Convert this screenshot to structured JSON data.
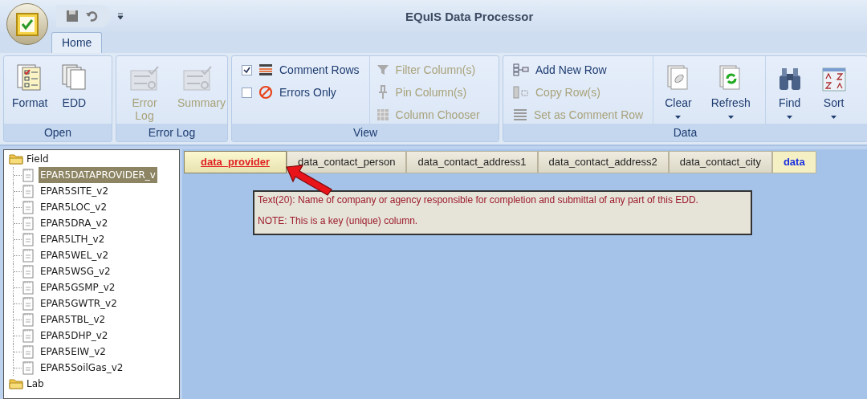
{
  "window": {
    "title": "EQuIS Data Processor"
  },
  "tabs": [
    {
      "label": "Home",
      "selected": true
    }
  ],
  "ribbon": {
    "groups": [
      {
        "label": "Open",
        "items": [
          {
            "kind": "large",
            "label": "Format",
            "disabled": false
          },
          {
            "kind": "large",
            "label": "EDD",
            "disabled": false
          }
        ]
      },
      {
        "label": "Error Log",
        "items": [
          {
            "kind": "large",
            "label": "Error Log",
            "disabled": true
          },
          {
            "kind": "large",
            "label": "Summary",
            "disabled": true
          }
        ]
      },
      {
        "label": "View",
        "columns": [
          [
            {
              "kind": "check",
              "label": "Comment Rows",
              "checked": true,
              "disabled": false
            },
            {
              "kind": "check",
              "label": "Errors Only",
              "checked": false,
              "disabled": false
            }
          ],
          [
            {
              "kind": "small",
              "label": "Filter Column(s)",
              "disabled": true
            },
            {
              "kind": "small",
              "label": "Pin Column(s)",
              "disabled": true
            },
            {
              "kind": "small",
              "label": "Column Chooser",
              "disabled": true
            }
          ]
        ]
      },
      {
        "label": "Data",
        "columns": [
          [
            {
              "kind": "small",
              "label": "Add New Row",
              "disabled": false
            },
            {
              "kind": "small",
              "label": "Copy Row(s)",
              "disabled": true
            },
            {
              "kind": "small",
              "label": "Set as Comment Row",
              "disabled": true
            }
          ],
          [
            {
              "kind": "large",
              "label": "Clear",
              "dropdown": true,
              "disabled": false
            },
            {
              "kind": "large",
              "label": "Refresh",
              "dropdown": true,
              "disabled": false
            }
          ],
          [
            {
              "kind": "large",
              "label": "Find",
              "dropdown": true,
              "disabled": false
            },
            {
              "kind": "large",
              "label": "Sort",
              "dropdown": true,
              "disabled": false
            }
          ]
        ]
      }
    ]
  },
  "tree": [
    {
      "label": "Field",
      "children": [
        {
          "label": "EPAR5DATAPROVIDER_v",
          "selected": true
        },
        {
          "label": "EPAR5SITE_v2",
          "selected": false
        },
        {
          "label": "EPAR5LOC_v2",
          "selected": false
        },
        {
          "label": "EPAR5DRA_v2",
          "selected": false
        },
        {
          "label": "EPAR5LTH_v2",
          "selected": false
        },
        {
          "label": "EPAR5WEL_v2",
          "selected": false
        },
        {
          "label": "EPAR5WSG_v2",
          "selected": false
        },
        {
          "label": "EPAR5GSMP_v2",
          "selected": false
        },
        {
          "label": "EPAR5GWTR_v2",
          "selected": false
        },
        {
          "label": "EPAR5TBL_v2",
          "selected": false
        },
        {
          "label": "EPAR5DHP_v2",
          "selected": false
        },
        {
          "label": "EPAR5EIW_v2",
          "selected": false
        },
        {
          "label": "EPAR5SoilGas_v2",
          "selected": false
        }
      ]
    },
    {
      "label": "Lab"
    }
  ],
  "columns": [
    {
      "label": "data_provider",
      "kind": "key",
      "selected": true
    },
    {
      "label": "data_contact_person",
      "kind": "normal",
      "selected": false
    },
    {
      "label": "data_contact_address1",
      "kind": "normal",
      "selected": false
    },
    {
      "label": "data_contact_address2",
      "kind": "normal",
      "selected": false
    },
    {
      "label": "data_contact_city",
      "kind": "normal",
      "selected": false
    },
    {
      "label": "data",
      "kind": "required",
      "selected": false
    }
  ],
  "tooltip": {
    "lines": [
      "Text(20): Name of company or agency responsible for completion and submittal of any part of this EDD.",
      "NOTE: This is a key (unique) column."
    ]
  }
}
